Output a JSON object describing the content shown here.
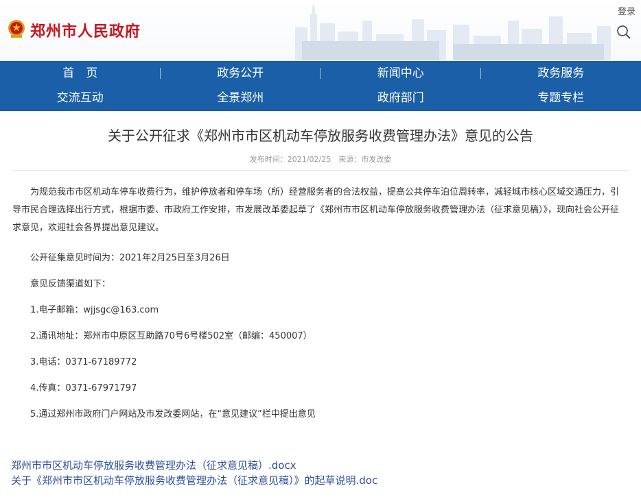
{
  "header": {
    "site_title": "郑州市人民政府",
    "login": "登录"
  },
  "nav": {
    "row1": [
      "首　页",
      "政务公开",
      "新闻中心",
      "政务服务"
    ],
    "row2": [
      "交流互动",
      "全景郑州",
      "政府部门",
      "专题专栏"
    ]
  },
  "article": {
    "title": "关于公开征求《郑州市市区机动车停放服务收费管理办法》意见的公告",
    "meta": "发布时间：2021/02/25　来源：市发改委",
    "intro": "为规范我市市区机动车停车收费行为，维护停放者和停车场（所）经营服务者的合法权益，提高公共停车泊位周转率，减轻城市核心区域交通压力，引导市民合理选择出行方式，根据市委、市政府工作安排，市发展改革委起草了《郑州市市区机动车停放服务收费管理办法（征求意见稿）》，现向社会公开征求意见，欢迎社会各界提出意见建议。",
    "period": "公开征集意见时间为：2021年2月25日至3月26日",
    "channels_heading": "意见反馈渠道如下：",
    "channels": [
      "1.电子邮箱：wjjsgc@163.com",
      "2.通讯地址：郑州市中原区互助路70号6号楼502室（邮编：450007）",
      "3.电话：0371-67189772",
      "4.传真：0371-67971797",
      "5.通过郑州市政府门户网站及市发改委网站，在“意见建议”栏中提出意见"
    ]
  },
  "attachments": [
    "郑州市市区机动车停放服务收费管理办法（征求意见稿）.docx",
    "关于《郑州市市区机动车停放服务收费管理办法（征求意见稿）》的起草说明.doc"
  ],
  "colors": {
    "brand_red": "#c8161d",
    "nav_blue": "#1b5fa8",
    "link_blue": "#2b4d9a"
  },
  "icons": [
    "national-emblem-icon",
    "search-icon"
  ]
}
